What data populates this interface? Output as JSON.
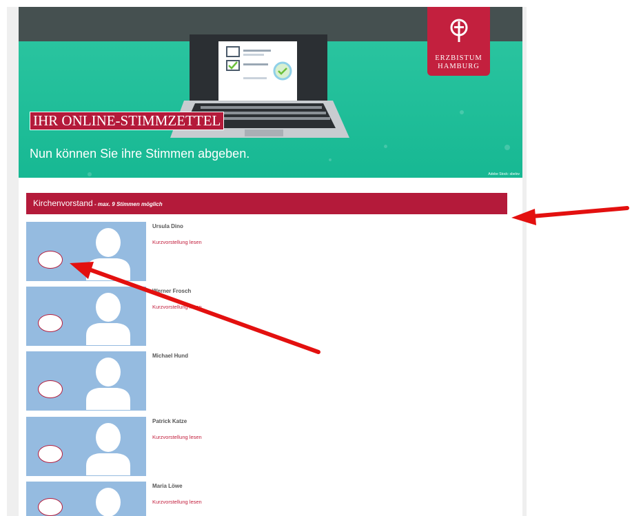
{
  "banner": {
    "logo_line1": "ERZBISTUM",
    "logo_line2": "HAMBURG",
    "title": "IHR ONLINE-STIMMZETTEL",
    "subtitle": "Nun können Sie ihre Stimmen abgeben.",
    "credit": "Adobe Stock: sbelov"
  },
  "section": {
    "title": "Kirchenvorstand",
    "subtitle": " - max. 9 Stimmen möglich"
  },
  "candidates": [
    {
      "name": "Ursula Dino",
      "link": "Kurzvorstellung lesen"
    },
    {
      "name": "Werner Frosch",
      "link": "Kurzvorstellung lesen"
    },
    {
      "name": "Michael Hund",
      "link": ""
    },
    {
      "name": "Patrick Katze",
      "link": "Kurzvorstellung lesen"
    },
    {
      "name": "Maria Löwe",
      "link": "Kurzvorstellung lesen"
    }
  ],
  "colors": {
    "accent": "#b41a3a",
    "photo_bg": "#95bbe0",
    "banner_green": "#1fbf98",
    "topbar": "#455050",
    "arrow": "#e3100f"
  }
}
